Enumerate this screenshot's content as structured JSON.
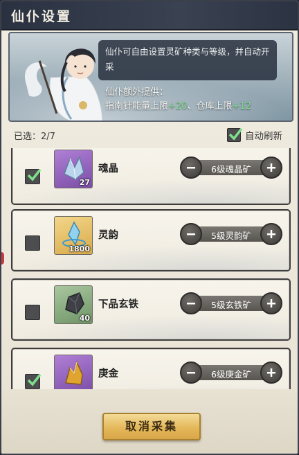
{
  "header": {
    "title": "仙仆设置"
  },
  "banner": {
    "speech": "仙仆可自由设置灵矿种类与等级，并自动开采",
    "bonus_heading": "仙仆额外提供：",
    "bonus_energy_label": "指南针能量上限",
    "bonus_energy_value": "+20",
    "bonus_sep": "、",
    "bonus_storage_label": "仓库上限",
    "bonus_storage_value": "+12"
  },
  "selection": {
    "selected_label": "已选：2/7"
  },
  "auto_refresh": {
    "label": "自动刷新",
    "checked": true
  },
  "ores": [
    {
      "name": "魂晶",
      "qty": "27",
      "level": "6级魂晶矿",
      "checked": true,
      "icon": "soul-crystal-icon"
    },
    {
      "name": "灵韵",
      "qty": "1800",
      "level": "5级灵韵矿",
      "checked": false,
      "icon": "spirit-crystal-icon"
    },
    {
      "name": "下品玄铁",
      "qty": "40",
      "level": "5级玄铁矿",
      "checked": false,
      "icon": "black-iron-icon"
    },
    {
      "name": "庚金",
      "qty": "",
      "level": "6级庚金矿",
      "checked": true,
      "icon": "geng-gold-icon"
    }
  ],
  "footer": {
    "cancel_label": "取消采集"
  },
  "colors": {
    "accent_green": "#7ee08a",
    "button_gold": "#e4b85a",
    "header_dark": "#2a3140"
  }
}
